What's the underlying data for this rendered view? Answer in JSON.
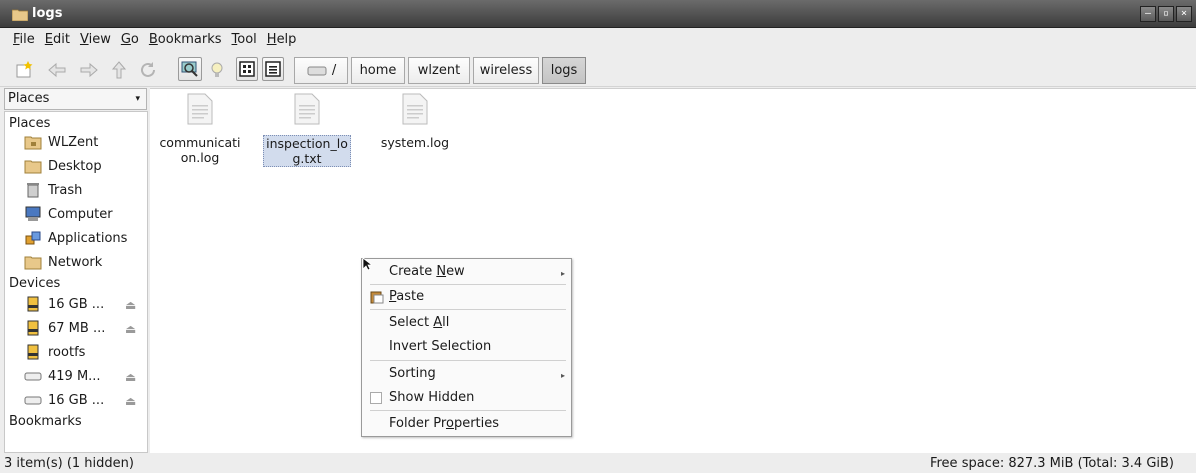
{
  "window": {
    "title": "logs"
  },
  "menu": [
    {
      "pre": "",
      "u": "F",
      "post": "ile"
    },
    {
      "pre": "",
      "u": "E",
      "post": "dit"
    },
    {
      "pre": "",
      "u": "V",
      "post": "iew"
    },
    {
      "pre": "",
      "u": "G",
      "post": "o"
    },
    {
      "pre": "",
      "u": "B",
      "post": "ookmarks"
    },
    {
      "pre": "",
      "u": "T",
      "post": "ool"
    },
    {
      "pre": "",
      "u": "H",
      "post": "elp"
    }
  ],
  "breadcrumbs": [
    "/",
    "home",
    "wlzent",
    "wireless",
    "logs"
  ],
  "sidebar": {
    "combo": "Places",
    "places_heading": "Places",
    "places": [
      "WLZent",
      "Desktop",
      "Trash",
      "Computer",
      "Applications",
      "Network"
    ],
    "devices_heading": "Devices",
    "devices": [
      "16 GB ...",
      "67 MB ...",
      "rootfs",
      "419 M...",
      "16 GB ..."
    ],
    "bookmarks_heading": "Bookmarks"
  },
  "files": [
    {
      "line1": "communicati",
      "line2": "on.log"
    },
    {
      "line1": "inspection_lo",
      "line2": "g.txt"
    },
    {
      "line1": "system.log",
      "line2": ""
    }
  ],
  "context_menu": {
    "create_new": {
      "pre": "Create ",
      "u": "N",
      "post": "ew"
    },
    "paste": {
      "pre": "",
      "u": "P",
      "post": "aste"
    },
    "select_all": {
      "pre": "Select ",
      "u": "A",
      "post": "ll"
    },
    "invert_selection": "Invert Selection",
    "sorting": "Sorting",
    "show_hidden": "Show Hidden",
    "folder_properties": {
      "pre": "Folder Pr",
      "u": "o",
      "post": "perties"
    }
  },
  "status": {
    "left": "3 item(s) (1 hidden)",
    "right": "Free space: 827.3 MiB (Total: 3.4 GiB)"
  },
  "colors": {
    "selection": "#d2dced",
    "folder": "#e8c88a",
    "drive": "#f0c040"
  }
}
